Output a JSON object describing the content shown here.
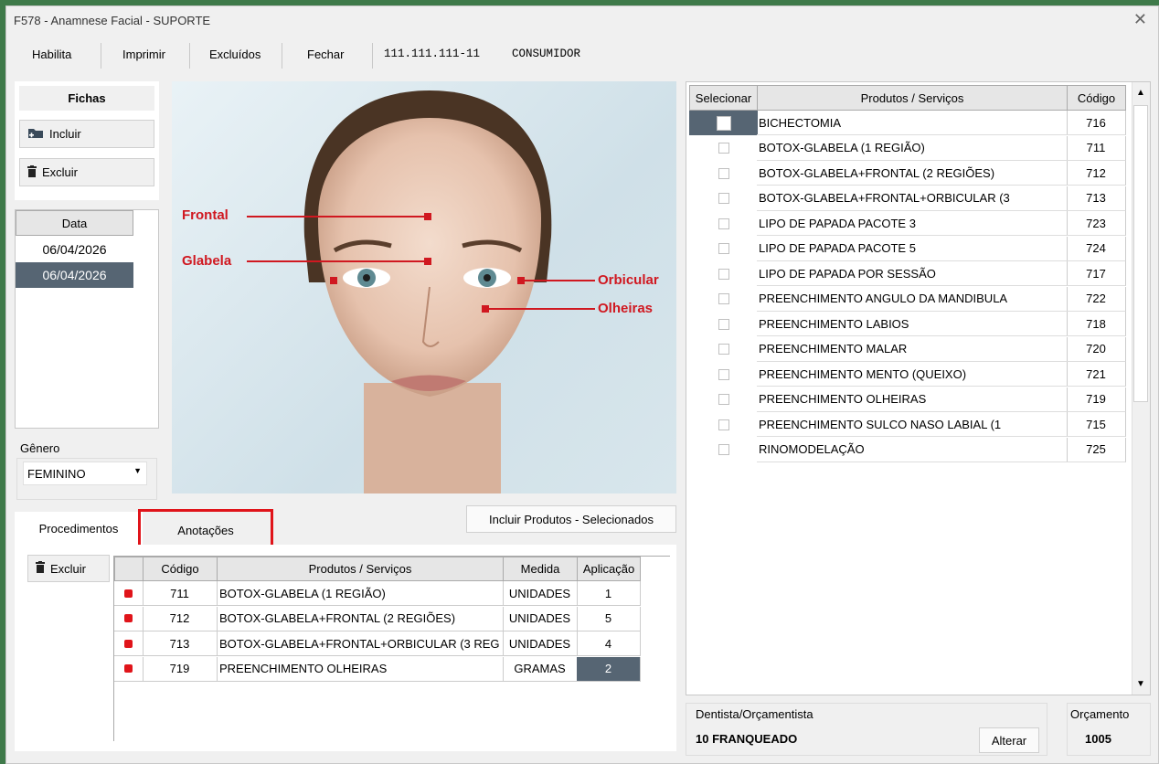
{
  "window": {
    "title": "F578 - Anamnese Facial  - SUPORTE"
  },
  "toolbar": {
    "habilita": "Habilita",
    "imprimir": "Imprimir",
    "excluidos": "Excluídos",
    "fechar": "Fechar",
    "cpf": "111.111.111-11",
    "cliente": "CONSUMIDOR"
  },
  "fichas": {
    "title": "Fichas",
    "incluir": "Incluir",
    "excluir": "Excluir",
    "data_header": "Data",
    "dates": [
      "06/04/2026",
      "06/04/2026"
    ]
  },
  "genero": {
    "label": "Gênero",
    "value": "FEMININO"
  },
  "face": {
    "labels": {
      "frontal": "Frontal",
      "glabela": "Glabela",
      "orbicular": "Orbicular",
      "olheiras": "Olheiras"
    }
  },
  "incluir_produtos": "Incluir Produtos - Selecionados",
  "tabs": {
    "procedimentos": "Procedimentos",
    "anotacoes": "Anotações"
  },
  "proc": {
    "excluir": "Excluir",
    "headers": {
      "codigo": "Código",
      "produtos": "Produtos / Serviços",
      "medida": "Medida",
      "aplicacao": "Aplicação"
    },
    "rows": [
      {
        "codigo": "711",
        "produto": "BOTOX-GLABELA (1 REGIÃO)",
        "medida": "UNIDADES",
        "aplicacao": "1"
      },
      {
        "codigo": "712",
        "produto": "BOTOX-GLABELA+FRONTAL (2 REGIÕES)",
        "medida": "UNIDADES",
        "aplicacao": "5"
      },
      {
        "codigo": "713",
        "produto": "BOTOX-GLABELA+FRONTAL+ORBICULAR (3 REG",
        "medida": "UNIDADES",
        "aplicacao": "4"
      },
      {
        "codigo": "719",
        "produto": "PREENCHIMENTO OLHEIRAS",
        "medida": "GRAMAS",
        "aplicacao": "2"
      }
    ]
  },
  "products": {
    "headers": {
      "selecionar": "Selecionar",
      "produtos": "Produtos / Serviços",
      "codigo": "Código"
    },
    "rows": [
      {
        "nome": "BICHECTOMIA",
        "codigo": "716"
      },
      {
        "nome": "BOTOX-GLABELA (1 REGIÃO)",
        "codigo": "711"
      },
      {
        "nome": "BOTOX-GLABELA+FRONTAL (2 REGIÕES)",
        "codigo": "712"
      },
      {
        "nome": "BOTOX-GLABELA+FRONTAL+ORBICULAR (3",
        "codigo": "713"
      },
      {
        "nome": "LIPO DE PAPADA PACOTE 3",
        "codigo": "723"
      },
      {
        "nome": "LIPO DE PAPADA PACOTE 5",
        "codigo": "724"
      },
      {
        "nome": "LIPO DE PAPADA POR SESSÃO",
        "codigo": "717"
      },
      {
        "nome": "PREENCHIMENTO ANGULO DA MANDIBULA",
        "codigo": "722"
      },
      {
        "nome": "PREENCHIMENTO LABIOS",
        "codigo": "718"
      },
      {
        "nome": "PREENCHIMENTO MALAR",
        "codigo": "720"
      },
      {
        "nome": "PREENCHIMENTO MENTO (QUEIXO)",
        "codigo": "721"
      },
      {
        "nome": "PREENCHIMENTO OLHEIRAS",
        "codigo": "719"
      },
      {
        "nome": "PREENCHIMENTO SULCO NASO LABIAL (1",
        "codigo": "715"
      },
      {
        "nome": "RINOMODELAÇÃO",
        "codigo": "725"
      }
    ]
  },
  "dentista": {
    "label": "Dentista/Orçamentista",
    "value": "10  FRANQUEADO",
    "alterar": "Alterar"
  },
  "orcamento": {
    "label": "Orçamento",
    "value": "1005"
  }
}
